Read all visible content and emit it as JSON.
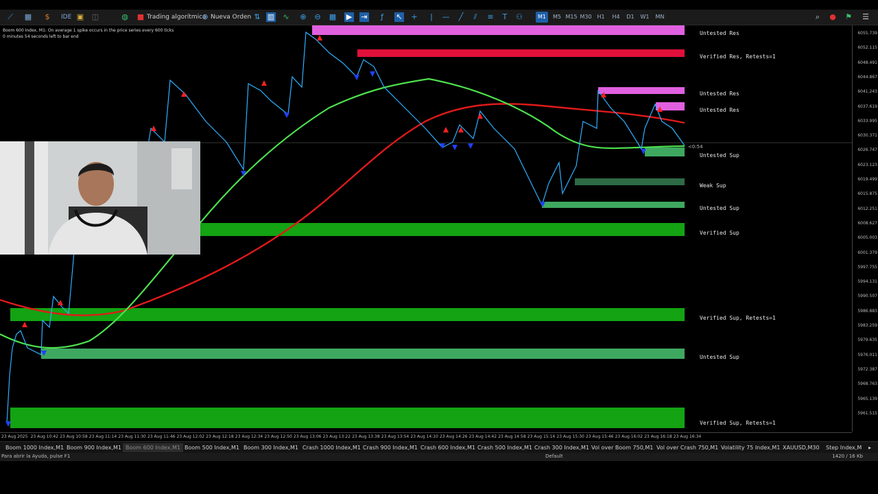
{
  "toolbar": {
    "ide_label": "IDE",
    "algo_label": "Trading algorítmico",
    "new_order_label": "Nueva Orden",
    "timeframes": [
      "M1",
      "M5",
      "M15",
      "M30",
      "H1",
      "H4",
      "D1",
      "W1",
      "MN"
    ],
    "active_timeframe": "M1"
  },
  "chart": {
    "title_line1": "Boom 600 Index, M1:  On average 1 spike occurs in the price series every 600 ticks",
    "title_line2": "0 minutes 54 seconds left to bar end",
    "price_ticks": [
      "6055.739",
      "6052.115",
      "6048.491",
      "6044.867",
      "6041.243",
      "6037.619",
      "6033.995",
      "6030.371",
      "6026.747",
      "6023.123",
      "6019.499",
      "6015.875",
      "6012.251",
      "6008.627",
      "6005.003",
      "6001.379",
      "5997.755",
      "5994.131",
      "5990.507",
      "5986.883",
      "5983.259",
      "5979.635",
      "5976.011",
      "5972.387",
      "5968.763",
      "5965.139",
      "5961.515"
    ],
    "countdown": "<0:54",
    "time_labels": [
      "23 Aug 2025",
      "23 Aug 10:42",
      "23 Aug 10:58",
      "23 Aug 11:14",
      "23 Aug 11:30",
      "23 Aug 11:46",
      "23 Aug 12:02",
      "23 Aug 12:18",
      "23 Aug 12:34",
      "23 Aug 12:50",
      "23 Aug 13:06",
      "23 Aug 13:22",
      "23 Aug 13:38",
      "23 Aug 13:54",
      "23 Aug 14:10",
      "23 Aug 14:26",
      "23 Aug 14:42",
      "23 Aug 14:58",
      "23 Aug 15:14",
      "23 Aug 15:30",
      "23 Aug 15:46",
      "23 Aug 16:02",
      "23 Aug 16:18",
      "23 Aug 16:34"
    ],
    "zones": [
      {
        "label": "Untested Res",
        "color": "#e060e0"
      },
      {
        "label": "Verified Res, Retests=1",
        "color": "#e0103a"
      },
      {
        "label": "Untested Res",
        "color": "#e060e0"
      },
      {
        "label": "Untested Res",
        "color": "#e060e0"
      },
      {
        "label": "Untested Sup",
        "color": "#3fa860"
      },
      {
        "label": "Weak Sup",
        "color": "#2e6a45"
      },
      {
        "label": "Untested Sup",
        "color": "#3fa860"
      },
      {
        "label": "Verified Sup",
        "color": "#13a313"
      },
      {
        "label": "Verified Sup, Retests=1",
        "color": "#13a313"
      },
      {
        "label": "Untested Sup",
        "color": "#3fa860"
      },
      {
        "label": "Verified Sup, Retests=1",
        "color": "#13a313"
      }
    ]
  },
  "tabs": [
    "Boom 1000 Index,M1",
    "Boom 900 Index,M1",
    "Boom 600 Index,M1",
    "Boom 500 Index,M1",
    "Boom 300 Index,M1",
    "Crash 1000 Index,M1",
    "Crash 900 Index,M1",
    "Crash 600 Index,M1",
    "Crash 500 Index,M1",
    "Crash 300 Index,M1",
    "Vol over Boom 750,M1",
    "Vol over Crash 750,M1",
    "Volatility 75 Index,M1",
    "XAUUSD,M30",
    "Step Index,M"
  ],
  "active_tab": "Boom 600 Index,M1",
  "status": {
    "help": "Para abrir la Ayuda, pulse F1",
    "profile": "Default",
    "traffic": "1420 / 16 Kb"
  }
}
